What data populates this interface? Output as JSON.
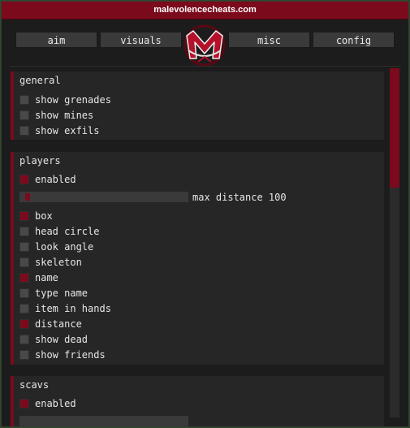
{
  "window": {
    "title": "malevolencecheats.com"
  },
  "tabs": [
    {
      "label": "aim"
    },
    {
      "label": "visuals"
    },
    {
      "label": "misc"
    },
    {
      "label": "config"
    }
  ],
  "logo": {
    "name": "malevolence-logo"
  },
  "sections": {
    "general": {
      "title": "general",
      "items": [
        {
          "label": "show grenades",
          "checked": false
        },
        {
          "label": "show mines",
          "checked": false
        },
        {
          "label": "show exfils",
          "checked": false
        }
      ]
    },
    "players": {
      "title": "players",
      "enabled": {
        "label": "enabled",
        "checked": true
      },
      "slider": {
        "label": "max distance 100",
        "value": 100
      },
      "items": [
        {
          "label": "box",
          "checked": true
        },
        {
          "label": "head circle",
          "checked": false
        },
        {
          "label": "look angle",
          "checked": false
        },
        {
          "label": "skeleton",
          "checked": false
        },
        {
          "label": "name",
          "checked": true
        },
        {
          "label": "type name",
          "checked": false
        },
        {
          "label": "item in hands",
          "checked": false
        },
        {
          "label": "distance",
          "checked": true
        },
        {
          "label": "show dead",
          "checked": false
        },
        {
          "label": "show friends",
          "checked": false
        }
      ]
    },
    "scavs": {
      "title": "scavs",
      "enabled": {
        "label": "enabled",
        "checked": true
      }
    }
  },
  "colors": {
    "accent": "#7b0a1c",
    "checked": "#7b0a1c",
    "unchecked": "#494949"
  }
}
